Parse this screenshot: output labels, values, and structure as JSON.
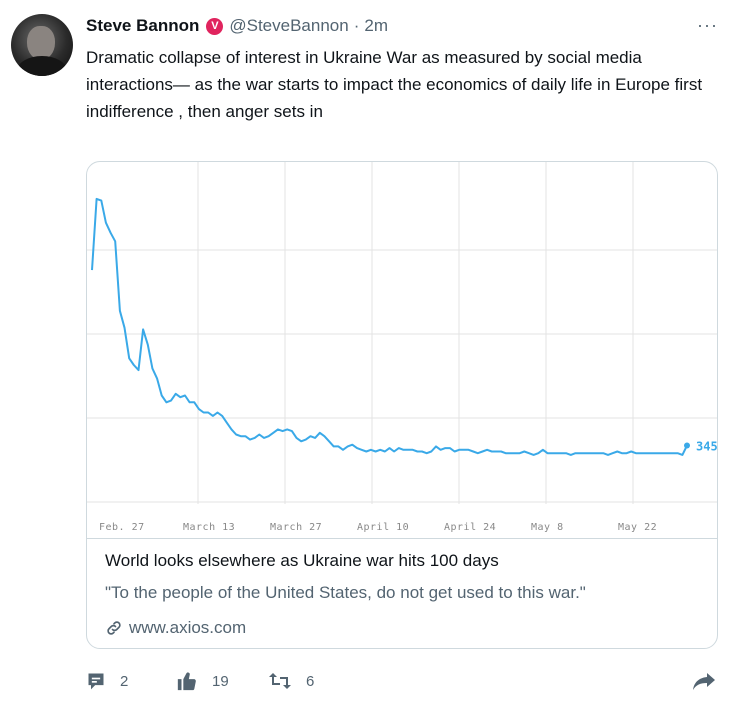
{
  "tweet": {
    "author_name": "Steve Bannon",
    "verified_badge": "V",
    "handle": "@SteveBannon",
    "separator": "·",
    "time": "2m",
    "more": "···",
    "text": "Dramatic collapse of interest in Ukraine War as measured by social media interactions— as the war starts to impact the economics of daily life in Europe first indifference , then anger sets in"
  },
  "card": {
    "title": "World looks elsewhere as Ukraine war hits 100 days",
    "description": "\"To the people of the United States, do not get used to this war.\"",
    "domain": "www.axios.com"
  },
  "actions": {
    "replies": "2",
    "likes": "19",
    "retweets": "6"
  },
  "colors": {
    "line": "#3aa9e8",
    "grid": "#e3e3e3",
    "badge": "#e0245e",
    "muted": "#536471"
  },
  "chart_data": {
    "type": "line",
    "title": "",
    "xlabel": "",
    "ylabel": "",
    "x_ticks": [
      "Feb. 27",
      "March 13",
      "March 27",
      "April 10",
      "April 24",
      "May 8",
      "May 22"
    ],
    "end_label": "345",
    "grid": true,
    "series": [
      {
        "values": [
          1380,
          1800,
          1790,
          1660,
          1600,
          1550,
          1140,
          1040,
          860,
          820,
          790,
          1030,
          940,
          800,
          740,
          640,
          600,
          610,
          650,
          630,
          640,
          600,
          600,
          560,
          540,
          540,
          520,
          540,
          520,
          480,
          440,
          410,
          400,
          400,
          380,
          390,
          410,
          390,
          400,
          420,
          440,
          430,
          440,
          430,
          390,
          370,
          380,
          400,
          390,
          420,
          400,
          370,
          340,
          340,
          320,
          340,
          350,
          330,
          320,
          310,
          320,
          310,
          320,
          310,
          330,
          310,
          330,
          320,
          320,
          320,
          310,
          310,
          300,
          310,
          340,
          320,
          330,
          330,
          310,
          320,
          320,
          320,
          310,
          300,
          310,
          320,
          310,
          310,
          310,
          300,
          300,
          300,
          300,
          310,
          300,
          290,
          300,
          320,
          300,
          300,
          300,
          300,
          300,
          290,
          300,
          300,
          300,
          300,
          300,
          300,
          300,
          290,
          300,
          310,
          300,
          300,
          310,
          300,
          300,
          300,
          300,
          300,
          300,
          300,
          300,
          300,
          300,
          290,
          345
        ]
      }
    ]
  }
}
